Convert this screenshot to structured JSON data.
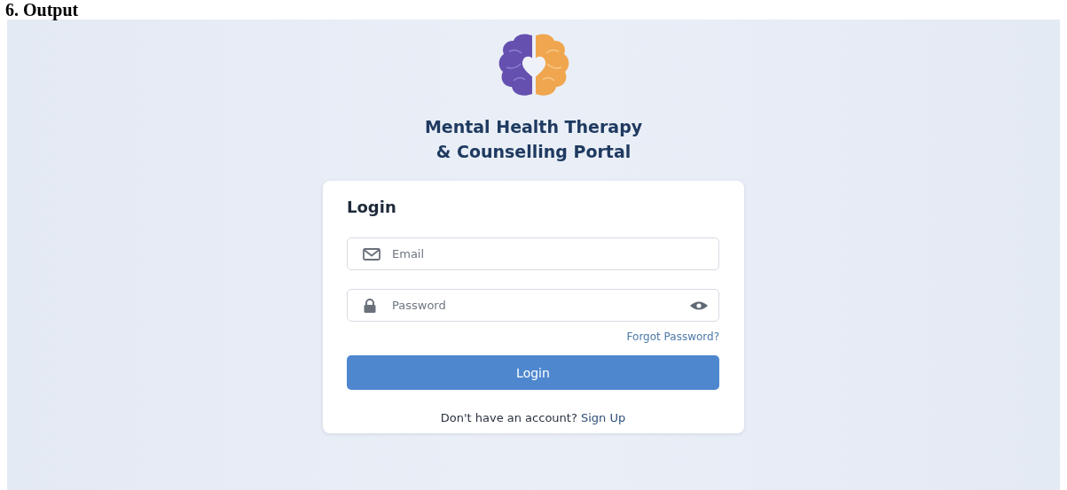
{
  "document_heading": "6. Output",
  "portal": {
    "title_lines": [
      "Mental Health Therapy",
      "& Counselling Portal"
    ]
  },
  "login_card": {
    "heading": "Login",
    "fields": [
      {
        "kind": "email",
        "placeholder": "Email"
      },
      {
        "kind": "password",
        "placeholder": "Password"
      }
    ],
    "forgot_link": "Forgot Password?",
    "submit_button": "Login",
    "signup_prompt": "Don't have an account?",
    "signup_link": "Sign Up"
  }
}
